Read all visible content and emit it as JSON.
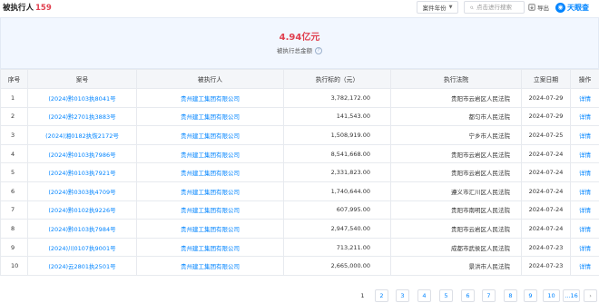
{
  "header": {
    "title": "被执行人",
    "count": "159",
    "sort_label": "案件年份",
    "search_placeholder": "点击进行搜索",
    "export_label": "导出",
    "logo_text": "天眼查",
    "accent_color": "#0084ff",
    "highlight_color": "#e0404f"
  },
  "summary": {
    "amount": "4.94亿元",
    "label": "被执行总金额"
  },
  "table": {
    "columns": [
      "序号",
      "案号",
      "被执行人",
      "执行标的（元）",
      "执行法院",
      "立案日期",
      "操作"
    ],
    "rows": [
      {
        "idx": "1",
        "case_no": "(2024)黔0103执8041号",
        "party": "贵州建工集团有限公司",
        "amount": "3,782,172.00",
        "court": "贵阳市云岩区人民法院",
        "date": "2024-07-29",
        "action": "详情"
      },
      {
        "idx": "2",
        "case_no": "(2024)黔2701执3883号",
        "party": "贵州建工集团有限公司",
        "amount": "141,543.00",
        "court": "都匀市人民法院",
        "date": "2024-07-29",
        "action": "详情"
      },
      {
        "idx": "3",
        "case_no": "(2024)湘0182执恢2172号",
        "party": "贵州建工集团有限公司",
        "amount": "1,508,919.00",
        "court": "宁乡市人民法院",
        "date": "2024-07-25",
        "action": "详情"
      },
      {
        "idx": "4",
        "case_no": "(2024)黔0103执7986号",
        "party": "贵州建工集团有限公司",
        "amount": "8,541,668.00",
        "court": "贵阳市云岩区人民法院",
        "date": "2024-07-24",
        "action": "详情"
      },
      {
        "idx": "5",
        "case_no": "(2024)黔0103执7921号",
        "party": "贵州建工集团有限公司",
        "amount": "2,331,823.00",
        "court": "贵阳市云岩区人民法院",
        "date": "2024-07-24",
        "action": "详情"
      },
      {
        "idx": "6",
        "case_no": "(2024)黔0303执4709号",
        "party": "贵州建工集团有限公司",
        "amount": "1,740,644.00",
        "court": "遵义市汇川区人民法院",
        "date": "2024-07-24",
        "action": "详情"
      },
      {
        "idx": "7",
        "case_no": "(2024)黔0102执9226号",
        "party": "贵州建工集团有限公司",
        "amount": "607,995.00",
        "court": "贵阳市南明区人民法院",
        "date": "2024-07-24",
        "action": "详情"
      },
      {
        "idx": "8",
        "case_no": "(2024)黔0103执7984号",
        "party": "贵州建工集团有限公司",
        "amount": "2,947,540.00",
        "court": "贵阳市云岩区人民法院",
        "date": "2024-07-24",
        "action": "详情"
      },
      {
        "idx": "9",
        "case_no": "(2024)川0107执9001号",
        "party": "贵州建工集团有限公司",
        "amount": "713,211.00",
        "court": "成都市武侯区人民法院",
        "date": "2024-07-23",
        "action": "详情"
      },
      {
        "idx": "10",
        "case_no": "(2024)云2801执2501号",
        "party": "贵州建工集团有限公司",
        "amount": "2,665,000.00",
        "court": "景洪市人民法院",
        "date": "2024-07-23",
        "action": "详情"
      }
    ]
  },
  "pagination": {
    "current": "1",
    "pages": [
      "2",
      "3",
      "4",
      "5",
      "6",
      "7",
      "8",
      "9",
      "10"
    ],
    "last": "...16",
    "next": "›"
  }
}
